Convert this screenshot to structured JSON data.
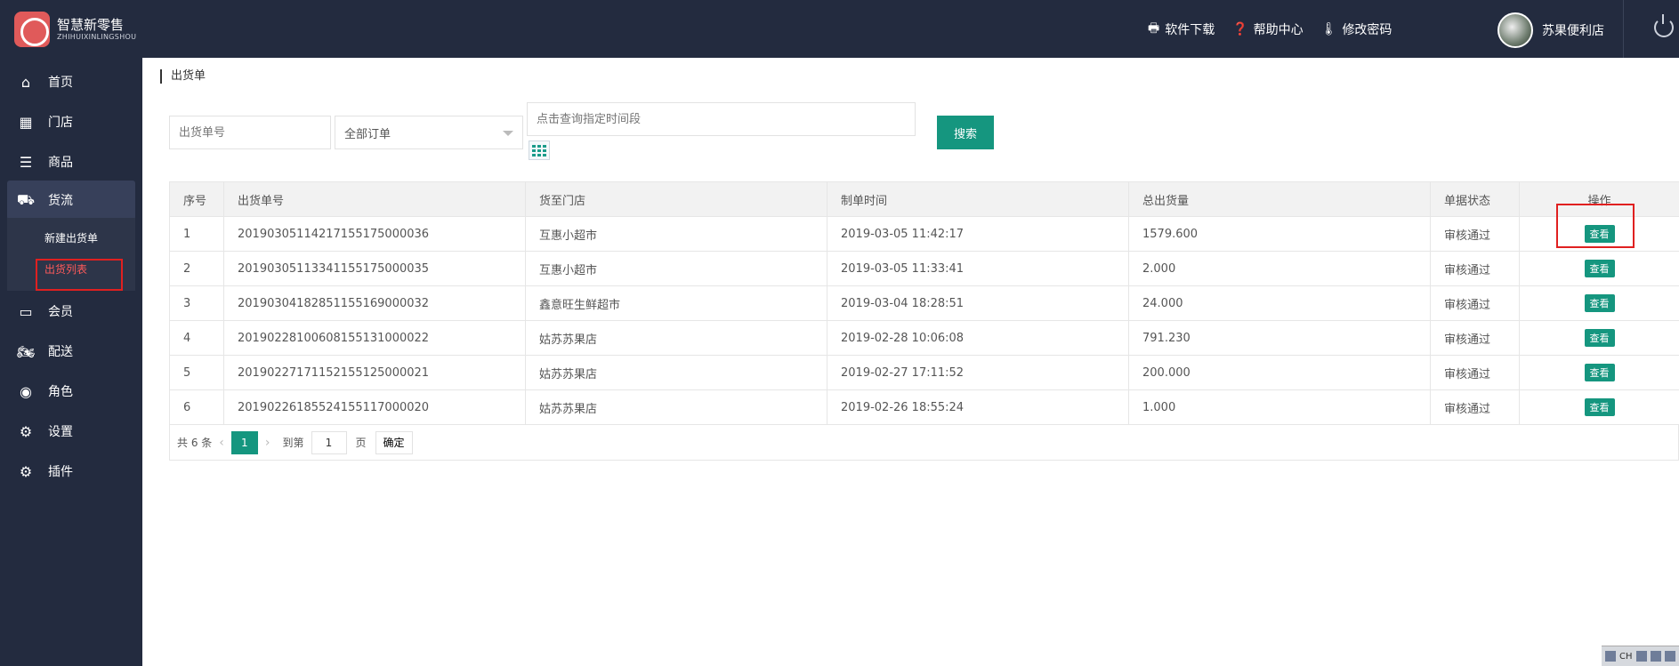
{
  "app": {
    "title": "智慧新零售",
    "subtitle": "ZHIHUIXINLINGSHOU"
  },
  "topbar": {
    "links": [
      {
        "label": "软件下载",
        "icon": "printer-icon"
      },
      {
        "label": "帮助中心",
        "icon": "question-icon"
      },
      {
        "label": "修改密码",
        "icon": "thermometer-icon"
      }
    ],
    "user_name": "苏果便利店"
  },
  "sidebar": {
    "items": [
      {
        "label": "首页",
        "icon": "home-icon"
      },
      {
        "label": "门店",
        "icon": "building-icon"
      },
      {
        "label": "商品",
        "icon": "list-icon"
      },
      {
        "label": "货流",
        "icon": "truck-icon"
      },
      {
        "label": "会员",
        "icon": "id-card-icon"
      },
      {
        "label": "配送",
        "icon": "motorcycle-icon"
      },
      {
        "label": "角色",
        "icon": "user-circle-icon"
      },
      {
        "label": "设置",
        "icon": "gear-icon"
      },
      {
        "label": "插件",
        "icon": "gears-icon"
      }
    ],
    "sub_items": [
      "新建出货单",
      "出货列表"
    ]
  },
  "breadcrumb": "出货单",
  "filter": {
    "order_no_placeholder": "出货单号",
    "order_type_value": "全部订单",
    "date_placeholder": "点击查询指定时间段",
    "search_label": "搜索"
  },
  "table": {
    "columns": [
      "序号",
      "出货单号",
      "货至门店",
      "制单时间",
      "总出货量",
      "单据状态",
      "操作"
    ],
    "rows": [
      {
        "no": "1",
        "order": "20190305114217155175000036",
        "store": "互惠小超市",
        "time": "2019-03-05 11:42:17",
        "qty": "1579.600",
        "status": "审核通过",
        "action": "查看"
      },
      {
        "no": "2",
        "order": "20190305113341155175000035",
        "store": "互惠小超市",
        "time": "2019-03-05 11:33:41",
        "qty": "2.000",
        "status": "审核通过",
        "action": "查看"
      },
      {
        "no": "3",
        "order": "20190304182851155169000032",
        "store": "鑫意旺生鲜超市",
        "time": "2019-03-04 18:28:51",
        "qty": "24.000",
        "status": "审核通过",
        "action": "查看"
      },
      {
        "no": "4",
        "order": "20190228100608155131000022",
        "store": "姑苏苏果店",
        "time": "2019-02-28 10:06:08",
        "qty": "791.230",
        "status": "审核通过",
        "action": "查看"
      },
      {
        "no": "5",
        "order": "20190227171152155125000021",
        "store": "姑苏苏果店",
        "time": "2019-02-27 17:11:52",
        "qty": "200.000",
        "status": "审核通过",
        "action": "查看"
      },
      {
        "no": "6",
        "order": "20190226185524155117000020",
        "store": "姑苏苏果店",
        "time": "2019-02-26 18:55:24",
        "qty": "1.000",
        "status": "审核通过",
        "action": "查看"
      }
    ]
  },
  "pager": {
    "total": "共 6 条",
    "current": "1",
    "goto_label": "到第",
    "page_input": "1",
    "page_suffix": "页",
    "confirm": "确定"
  },
  "tray": {
    "lang": "CH"
  },
  "colors": {
    "primary": "#15967f",
    "nav_bg": "#232b3f",
    "highlight": "#e02020"
  }
}
